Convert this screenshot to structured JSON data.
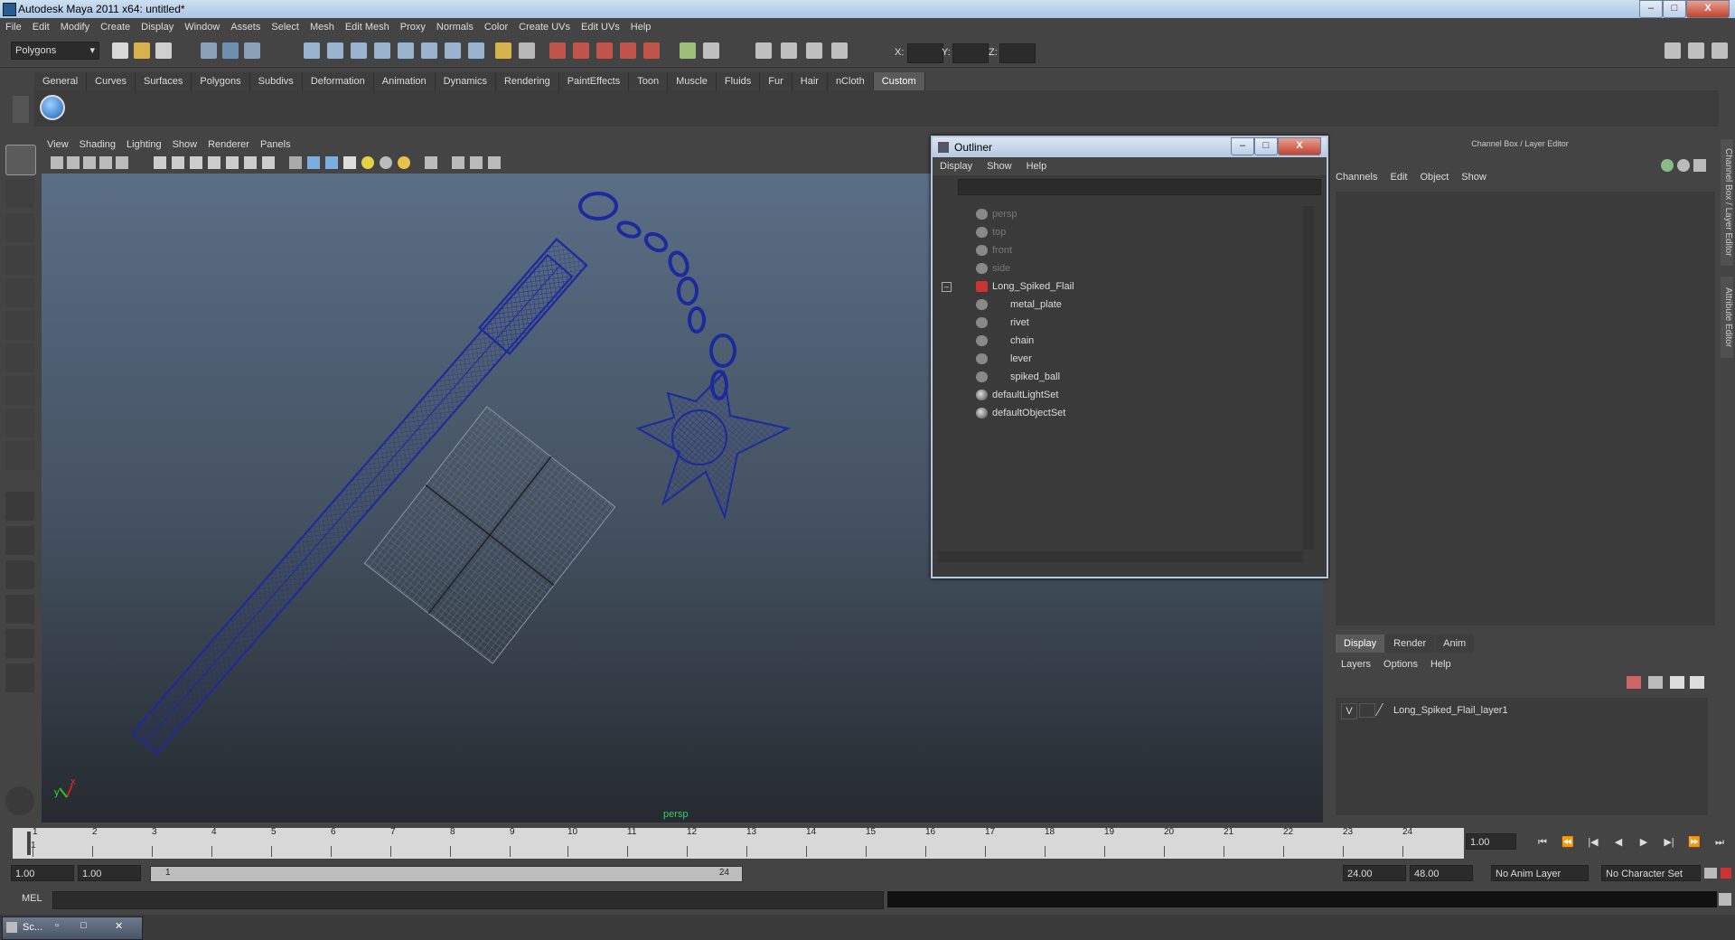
{
  "window": {
    "title": "Autodesk Maya 2011 x64: untitled*",
    "min_label": "–",
    "max_label": "□",
    "close_label": "X"
  },
  "menubar": [
    "File",
    "Edit",
    "Modify",
    "Create",
    "Display",
    "Window",
    "Assets",
    "Select",
    "Mesh",
    "Edit Mesh",
    "Proxy",
    "Normals",
    "Color",
    "Create UVs",
    "Edit UVs",
    "Help"
  ],
  "toolbar": {
    "mode_select": "Polygons",
    "x_label": "X:",
    "y_label": "Y:",
    "z_label": "Z:"
  },
  "shelf": {
    "tabs": [
      "General",
      "Curves",
      "Surfaces",
      "Polygons",
      "Subdivs",
      "Deformation",
      "Animation",
      "Dynamics",
      "Rendering",
      "PaintEffects",
      "Toon",
      "Muscle",
      "Fluids",
      "Fur",
      "Hair",
      "nCloth",
      "Custom"
    ],
    "active": "Custom"
  },
  "viewport": {
    "menus": [
      "View",
      "Shading",
      "Lighting",
      "Show",
      "Renderer",
      "Panels"
    ],
    "camera_label": "persp",
    "axis_x": "x",
    "axis_y": "y"
  },
  "outliner": {
    "title": "Outliner",
    "menus": [
      "Display",
      "Show",
      "Help"
    ],
    "items": [
      {
        "label": "persp",
        "dim": true
      },
      {
        "label": "top",
        "dim": true
      },
      {
        "label": "front",
        "dim": true
      },
      {
        "label": "side",
        "dim": true
      },
      {
        "label": "Long_Spiked_Flail",
        "dim": false
      },
      {
        "label": "metal_plate",
        "dim": false
      },
      {
        "label": "rivet",
        "dim": false
      },
      {
        "label": "chain",
        "dim": false
      },
      {
        "label": "lever",
        "dim": false
      },
      {
        "label": "spiked_ball",
        "dim": false
      },
      {
        "label": "defaultLightSet",
        "dim": false
      },
      {
        "label": "defaultObjectSet",
        "dim": false
      }
    ],
    "collapse_glyph": "–"
  },
  "channel_box": {
    "header": "Channel Box / Layer Editor",
    "menus": [
      "Channels",
      "Edit",
      "Object",
      "Show"
    ],
    "layer_tabs": [
      "Display",
      "Render",
      "Anim"
    ],
    "layer_active": "Display",
    "layer_menus": [
      "Layers",
      "Options",
      "Help"
    ],
    "layer": {
      "visibility": "V",
      "name": "Long_Spiked_Flail_layer1"
    }
  },
  "side_tabs": [
    "Channel Box / Layer Editor",
    "Attribute Editor"
  ],
  "timeline": {
    "ticks": [
      "1",
      "2",
      "3",
      "4",
      "5",
      "6",
      "7",
      "8",
      "9",
      "10",
      "11",
      "12",
      "13",
      "14",
      "15",
      "16",
      "17",
      "18",
      "19",
      "20",
      "21",
      "22",
      "23",
      "24"
    ],
    "current_frame": "1.00",
    "current_marker": "1"
  },
  "range": {
    "start": "1.00",
    "playback_start": "1.00",
    "slider_start": "1",
    "slider_end": "24",
    "playback_end": "24.00",
    "end": "48.00",
    "anim_layer": "No Anim Layer",
    "character_set": "No Character Set"
  },
  "command_line": {
    "label": "MEL"
  },
  "taskbar": {
    "item": "Sc..."
  },
  "colors": {
    "wireframe": "#1c2a9c",
    "ui_bg": "#444444",
    "title_gradient": "#b5c8e0"
  }
}
